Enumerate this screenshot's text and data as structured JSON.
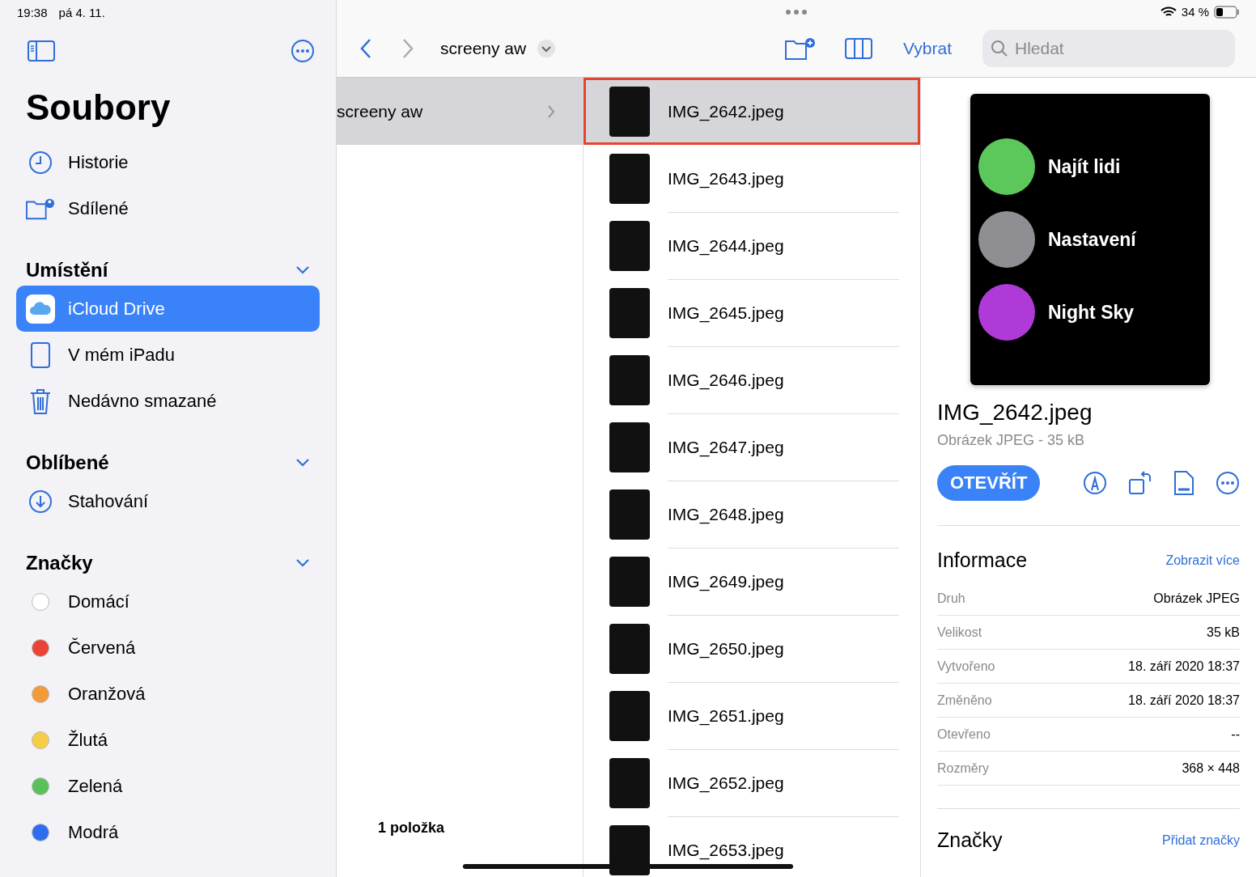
{
  "status_bar": {
    "time": "19:38",
    "date": "pá 4. 11.",
    "battery": "34 %"
  },
  "sidebar": {
    "title": "Soubory",
    "top_items": [
      {
        "label": "Historie",
        "kind": "clock"
      },
      {
        "label": "Sdílené",
        "kind": "shared"
      }
    ],
    "sections": [
      {
        "title": "Umístění",
        "expanded": true,
        "items": [
          {
            "label": "iCloud Drive",
            "kind": "cloud",
            "selected": true
          },
          {
            "label": "V mém iPadu",
            "kind": "ipad",
            "selected": false
          },
          {
            "label": "Nedávno smazané",
            "kind": "trash",
            "selected": false
          }
        ]
      },
      {
        "title": "Oblíbené",
        "expanded": true,
        "items": [
          {
            "label": "Stahování",
            "kind": "download",
            "selected": false
          }
        ]
      }
    ],
    "tags_title": "Značky",
    "tags_expanded": true,
    "tags": [
      {
        "label": "Domácí",
        "color": "#ffffff"
      },
      {
        "label": "Červená",
        "color": "#eb4335"
      },
      {
        "label": "Oranžová",
        "color": "#f29b38"
      },
      {
        "label": "Žlutá",
        "color": "#f7cd46"
      },
      {
        "label": "Zelená",
        "color": "#5ac05a"
      },
      {
        "label": "Modrá",
        "color": "#2f6df0"
      }
    ]
  },
  "toolbar": {
    "folder": "screeny aw",
    "select": "Vybrat",
    "search_placeholder": "Hledat"
  },
  "folder_column": {
    "items": [
      {
        "label": "screeny aw",
        "selected": true
      }
    ],
    "count": "1 položka"
  },
  "files": [
    {
      "name": "IMG_2642.jpeg",
      "selected": true
    },
    {
      "name": "IMG_2643.jpeg",
      "selected": false
    },
    {
      "name": "IMG_2644.jpeg",
      "selected": false
    },
    {
      "name": "IMG_2645.jpeg",
      "selected": false
    },
    {
      "name": "IMG_2646.jpeg",
      "selected": false
    },
    {
      "name": "IMG_2647.jpeg",
      "selected": false
    },
    {
      "name": "IMG_2648.jpeg",
      "selected": false
    },
    {
      "name": "IMG_2649.jpeg",
      "selected": false
    },
    {
      "name": "IMG_2650.jpeg",
      "selected": false
    },
    {
      "name": "IMG_2651.jpeg",
      "selected": false
    },
    {
      "name": "IMG_2652.jpeg",
      "selected": false
    },
    {
      "name": "IMG_2653.jpeg",
      "selected": false
    }
  ],
  "preview": {
    "image_items": [
      {
        "label": "Najít lidi",
        "color": "#5cc85c"
      },
      {
        "label": "Nastavení",
        "color": "#8e8e93"
      },
      {
        "label": "Night Sky",
        "color": "#b03ad8"
      }
    ],
    "name": "IMG_2642.jpeg",
    "subtitle": "Obrázek JPEG - 35 kB",
    "open": "OTEVŘÍT",
    "info_title": "Informace",
    "info_more": "Zobrazit více",
    "info": [
      {
        "label": "Druh",
        "value": "Obrázek JPEG"
      },
      {
        "label": "Velikost",
        "value": "35 kB"
      },
      {
        "label": "Vytvořeno",
        "value": "18. září 2020 18:37"
      },
      {
        "label": "Změněno",
        "value": "18. září 2020 18:37"
      },
      {
        "label": "Otevřeno",
        "value": "--"
      },
      {
        "label": "Rozměry",
        "value": "368 × 448"
      }
    ],
    "tags_title": "Značky",
    "tags_add": "Přidat značky"
  }
}
